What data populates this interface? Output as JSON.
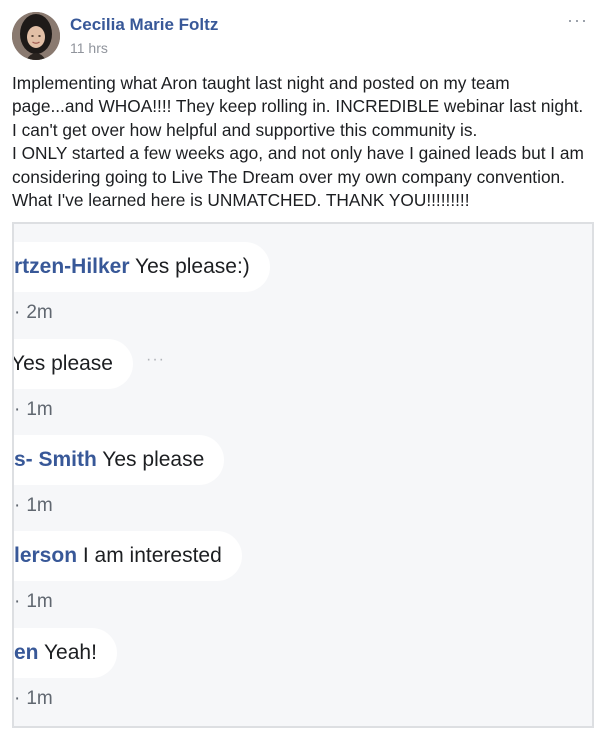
{
  "post": {
    "author": "Cecilia Marie Foltz",
    "time": "11 hrs",
    "more": "···",
    "lines": [
      "Implementing what Aron taught last night and posted on my team",
      "page...and WHOA!!!! They keep rolling in. INCREDIBLE webinar last night.",
      "I can't get over how helpful and supportive this community is.",
      "I ONLY started a few weeks ago, and not only have I gained leads but I am",
      "considering going to Live The Dream over my own company convention.",
      "What I've learned here is UNMATCHED. THANK YOU!!!!!!!!!"
    ]
  },
  "comments": [
    {
      "name": "rtzen-Hilker",
      "text": " Yes please:)",
      "meta": "2m"
    },
    {
      "name": "",
      "text": "Yes please",
      "meta": "1m",
      "dots": "···"
    },
    {
      "name": "s- Smith",
      "text": " Yes please",
      "meta": "1m"
    },
    {
      "name": "lerson",
      "text": " I am interested",
      "meta": "1m"
    },
    {
      "name": "en",
      "text": " Yeah!",
      "meta": "1m"
    }
  ],
  "meta_separator": "·"
}
